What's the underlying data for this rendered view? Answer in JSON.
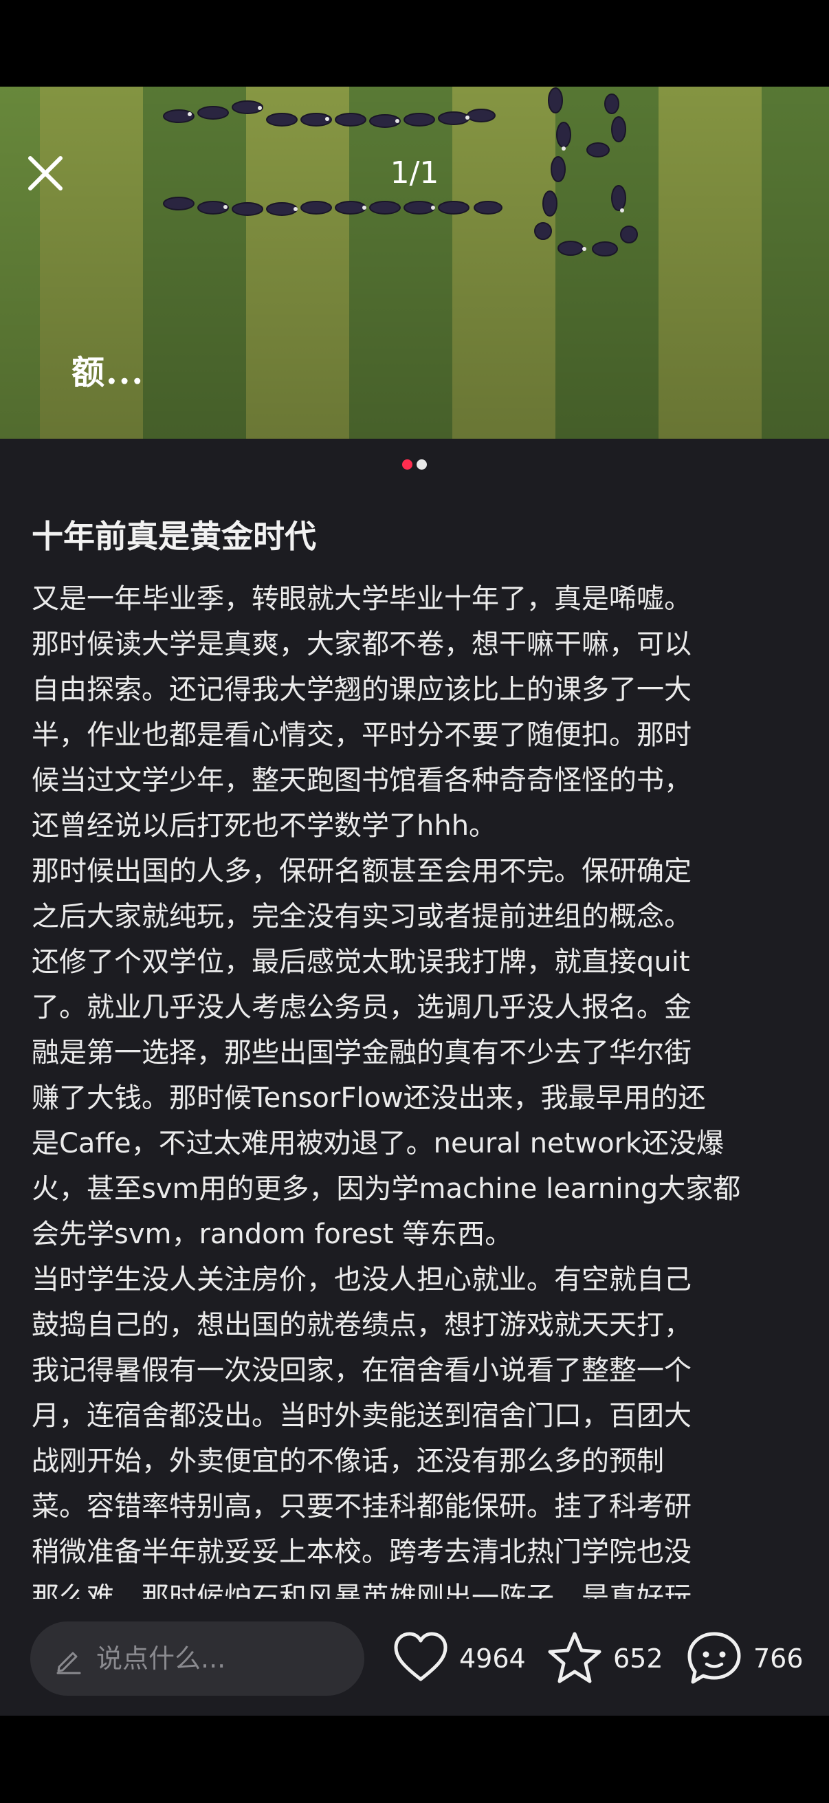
{
  "header": {
    "counter": "1/1",
    "close_icon": "close-icon",
    "watermark": "额..."
  },
  "post": {
    "title": "十年前真是黄金时代",
    "paragraphs": [
      "又是一年毕业季，转眼就大学毕业十年了，真是唏嘘。\n那时候读大学是真爽，大家都不卷，想干嘛干嘛，可以\n自由探索。还记得我大学翘的课应该比上的课多了一大\n半，作业也都是看心情交，平时分不要了随便扣。那时\n候当过文学少年，整天跑图书馆看各种奇奇怪怪的书，\n还曾经说以后打死也不学数学了hhh。",
      "那时候出国的人多，保研名额甚至会用不完。保研确定\n之后大家就纯玩，完全没有实习或者提前进组的概念。\n还修了个双学位，最后感觉太耽误我打牌，就直接quit\n了。就业几乎没人考虑公务员，选调几乎没人报名。金\n融是第一选择，那些出国学金融的真有不少去了华尔街\n赚了大钱。那时候TensorFlow还没出来，我最早用的还\n是Caffe，不过太难用被劝退了。neural network还没爆\n火，甚至svm用的更多，因为学machine learning大家都\n会先学svm，random forest 等东西。",
      "当时学生没人关注房价，也没人担心就业。有空就自己\n鼓捣自己的，想出国的就卷绩点，想打游戏就天天打，\n我记得暑假有一次没回家，在宿舍看小说看了整整一个\n月，连宿舍都没出。当时外卖能送到宿舍门口，百团大\n战刚开始，外卖便宜的不像话，还没有那么多的预制\n菜。容错率特别高，只要不挂科都能保研。挂了科考研\n稍微准备半年就妥妥上本校。跨考去清北热门学院也没\n那么难，那时候炉石和风暴英雄刚出一阵子，是真好玩"
    ]
  },
  "carousel": {
    "active_color": "#ff2d4f",
    "inactive_color": "#e8e8e8"
  },
  "bottom_bar": {
    "comment_placeholder": "说点什么...",
    "likes": "4964",
    "favorites": "652",
    "comments": "766",
    "icons": [
      "pencil-icon",
      "heart-icon",
      "star-icon",
      "chat-bubble-icon"
    ]
  }
}
